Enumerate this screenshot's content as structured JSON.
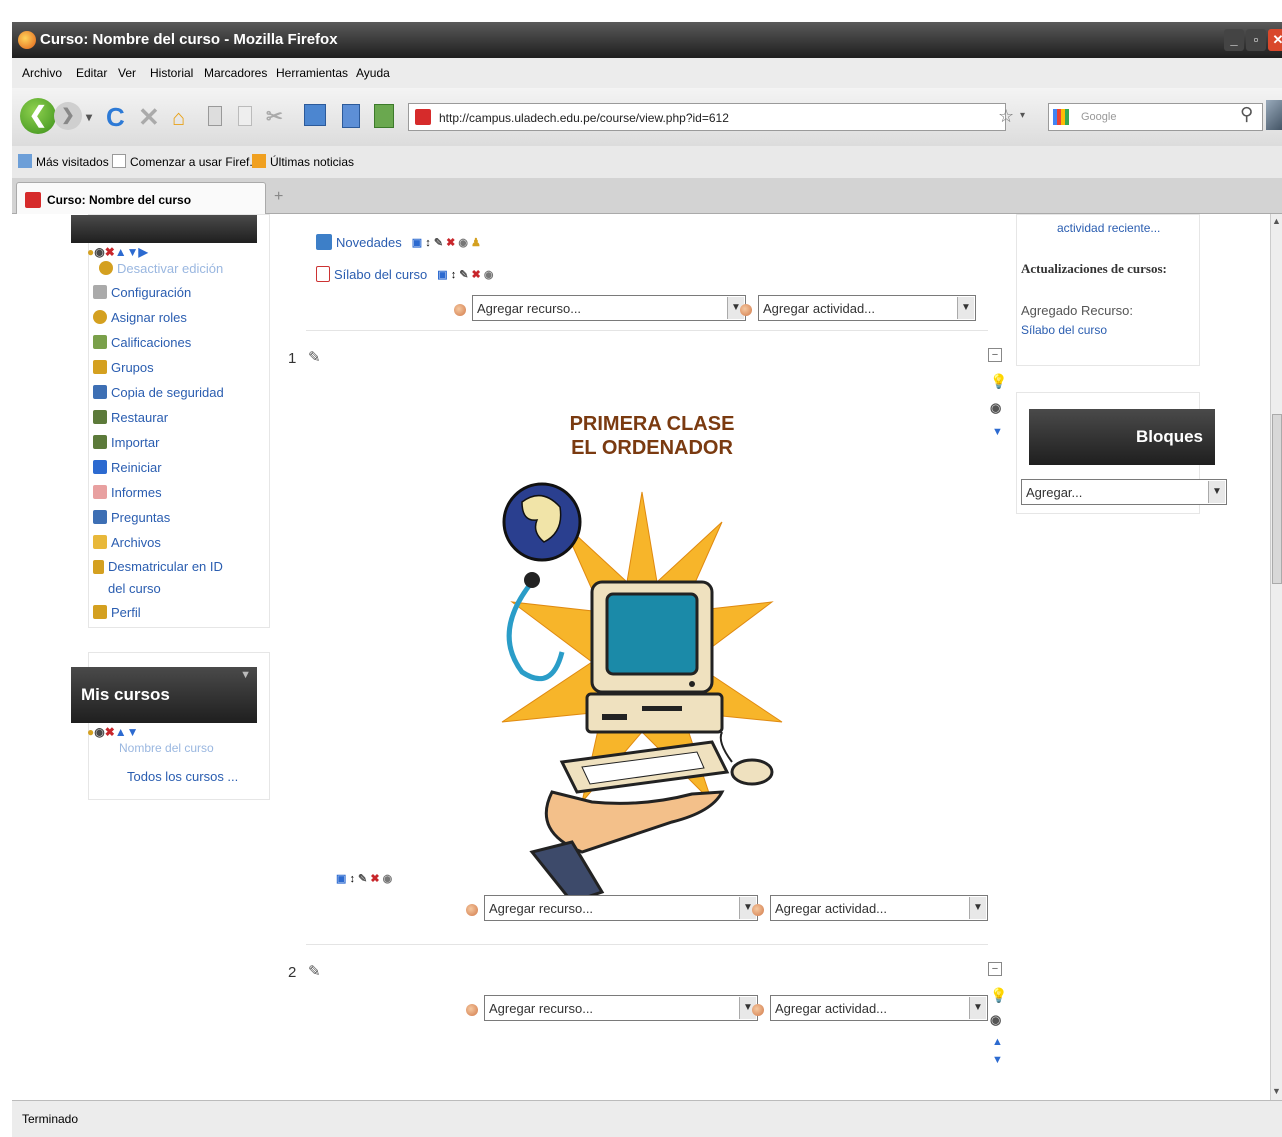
{
  "window": {
    "title": "Curso: Nombre del curso - Mozilla Firefox"
  },
  "menu": [
    "Archivo",
    "Editar",
    "Ver",
    "Historial",
    "Marcadores",
    "Herramientas",
    "Ayuda"
  ],
  "address": {
    "url": "http://campus.uladech.edu.pe/course/view.php?id=612"
  },
  "search": {
    "placeholder": "Google"
  },
  "bookmarks": [
    "Más visitados",
    "Comenzar a usar Firef...",
    "Últimas noticias"
  ],
  "tab": {
    "title": "Curso: Nombre del curso"
  },
  "admin_block": {
    "items": [
      "Desactivar edición",
      "Configuración",
      "Asignar roles",
      "Calificaciones",
      "Grupos",
      "Copia de seguridad",
      "Restaurar",
      "Importar",
      "Reiniciar",
      "Informes",
      "Preguntas",
      "Archivos",
      "Desmatricular en ID del curso",
      "Perfil"
    ]
  },
  "mycourses_block": {
    "title": "Mis cursos",
    "course": "Nombre del curso",
    "all_courses": "Todos los cursos ..."
  },
  "section0": {
    "items": [
      "Novedades",
      "Sílabo del curso"
    ],
    "add_resource": "Agregar recurso...",
    "add_activity": "Agregar actividad..."
  },
  "section1": {
    "number": "1",
    "poster_title_line1": "PRIMERA CLASE",
    "poster_title_line2": "EL ORDENADOR",
    "add_resource": "Agregar recurso...",
    "add_activity": "Agregar actividad..."
  },
  "section2": {
    "number": "2",
    "add_resource": "Agregar recurso...",
    "add_activity": "Agregar actividad..."
  },
  "recent_block": {
    "link": "actividad reciente...",
    "heading": "Actualizaciones de cursos:",
    "label": "Agregado Recurso:",
    "resource": "Sílabo del curso"
  },
  "blocks_block": {
    "title": "Bloques",
    "select": "Agregar..."
  },
  "status": {
    "text": "Terminado"
  },
  "colors": {
    "link": "#2a5db0",
    "poster_title": "#7a3a10",
    "block_header": "#2b2b2b"
  }
}
